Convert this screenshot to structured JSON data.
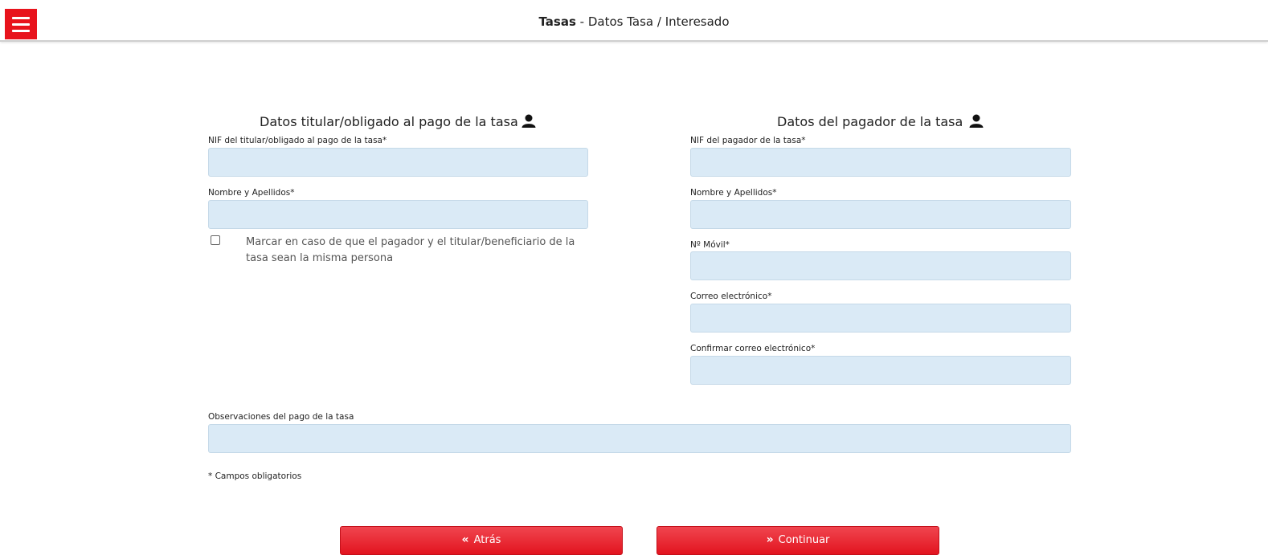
{
  "header": {
    "title_bold": "Tasas",
    "title_rest": " - Datos Tasa / Interesado"
  },
  "titular": {
    "section_title": "Datos titular/obligado al pago de la tasa",
    "nif_label": "NIF del titular/obligado al pago de la tasa*",
    "nif_value": "",
    "nombre_label": "Nombre y Apellidos*",
    "nombre_value": "",
    "checkbox_checked": false,
    "checkbox_text": "Marcar en caso de que el pagador y el titular/beneficiario de la tasa sean la misma persona"
  },
  "pagador": {
    "section_title": "Datos del pagador de la tasa",
    "nif_label": "NIF del pagador de la tasa*",
    "nif_value": "",
    "nombre_label": "Nombre y Apellidos*",
    "nombre_value": "",
    "movil_label": "Nº Móvil*",
    "movil_value": "",
    "correo_label": "Correo electrónico*",
    "correo_value": "",
    "confirmar_label": "Confirmar correo electrónico*",
    "confirmar_value": ""
  },
  "observaciones": {
    "label": "Observaciones del pago de la tasa",
    "value": ""
  },
  "required_note": "* Campos obligatorios",
  "buttons": {
    "back_label": "Atrás",
    "continue_label": "Continuar"
  },
  "colors": {
    "accent": "#e8131c",
    "input_bg": "#daeaf6"
  },
  "icons": {
    "menu": "hamburger-menu-icon",
    "user": "user-icon",
    "back": "double-chevron-left-icon",
    "continue": "double-chevron-right-icon"
  }
}
